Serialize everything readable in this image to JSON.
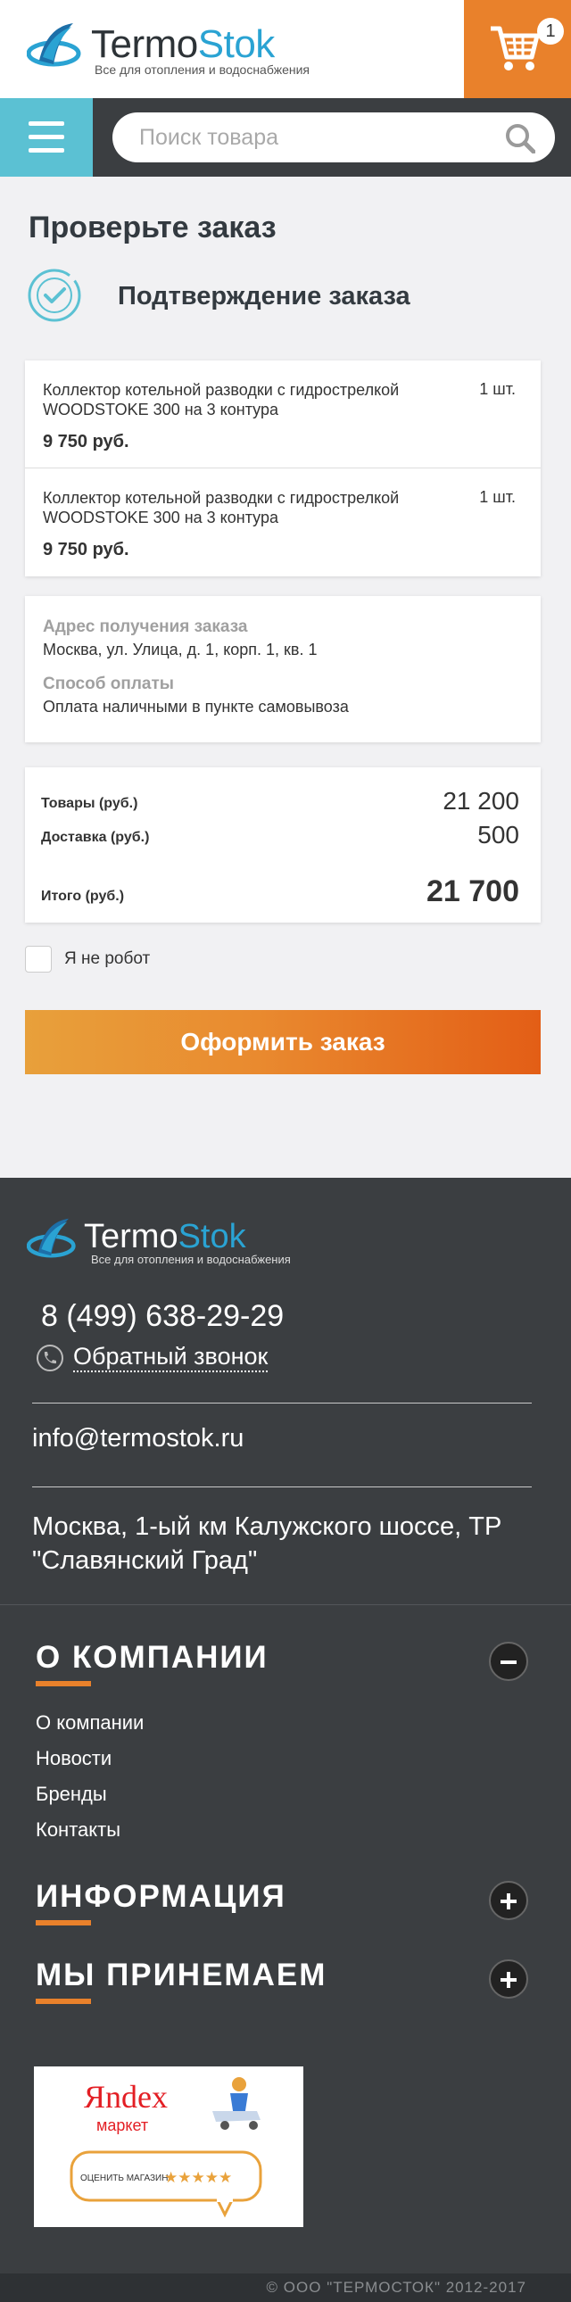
{
  "header": {
    "logo_main": "Termo",
    "logo_accent": "Stok",
    "logo_sub": "Все для отопления и водоснабжения",
    "cart_count": "1"
  },
  "search": {
    "placeholder": "Поиск товара"
  },
  "page": {
    "title": "Проверьте заказ",
    "subtitle": "Подтверждение заказа"
  },
  "items": [
    {
      "name": "Коллектор котельной разводки с гидрострелкой WOODSTOKE 300 на 3 контура",
      "qty": "1 шт.",
      "price": "9 750 руб."
    },
    {
      "name": "Коллектор котельной разводки с гидрострелкой WOODSTOKE 300 на 3 контура",
      "qty": "1 шт.",
      "price": "9 750 руб."
    }
  ],
  "info": {
    "address_label": "Адрес получения заказа",
    "address_value": "Москва, ул. Улица, д. 1, корп. 1, кв. 1",
    "payment_label": "Способ оплаты",
    "payment_value": "Оплата наличными в пункте самовывоза"
  },
  "totals": {
    "goods_label": "Товары (руб.)",
    "goods_value": "21 200",
    "delivery_label": "Доставка (руб.)",
    "delivery_value": "500",
    "total_label": "Итого (руб.)",
    "total_value": "21 700"
  },
  "robot_label": "Я не робот",
  "order_button": "Оформить заказ",
  "footer": {
    "logo_main": "Termo",
    "logo_accent": "Stok",
    "logo_sub": "Все для отопления и водоснабжения",
    "phone": "8 (499) 638-29-29",
    "callback": "Обратный звонок",
    "email": "info@termostok.ru",
    "address": "Москва, 1-ый км Калужского шоссе, ТР \"Славянский Град\"",
    "sections": [
      {
        "title": "О КОМПАНИИ",
        "expanded": true,
        "links": [
          "О компании",
          "Новости",
          "Бренды",
          "Контакты"
        ]
      },
      {
        "title": "ИНФОРМАЦИЯ",
        "expanded": false
      },
      {
        "title": "МЫ ПРИНЕМАЕМ",
        "expanded": false
      }
    ],
    "yandex_brand": "Яndex",
    "yandex_market": "маркет",
    "yandex_rate": "ОЦЕНИТЬ МАГАЗИН",
    "copyright": "© ООО \"ТЕРМОСТОК\" 2012-2017"
  },
  "colors": {
    "accent": "#e9812b",
    "brand_blue": "#2aa3d3",
    "dark": "#3b3e41",
    "menu": "#5bc1d3"
  }
}
